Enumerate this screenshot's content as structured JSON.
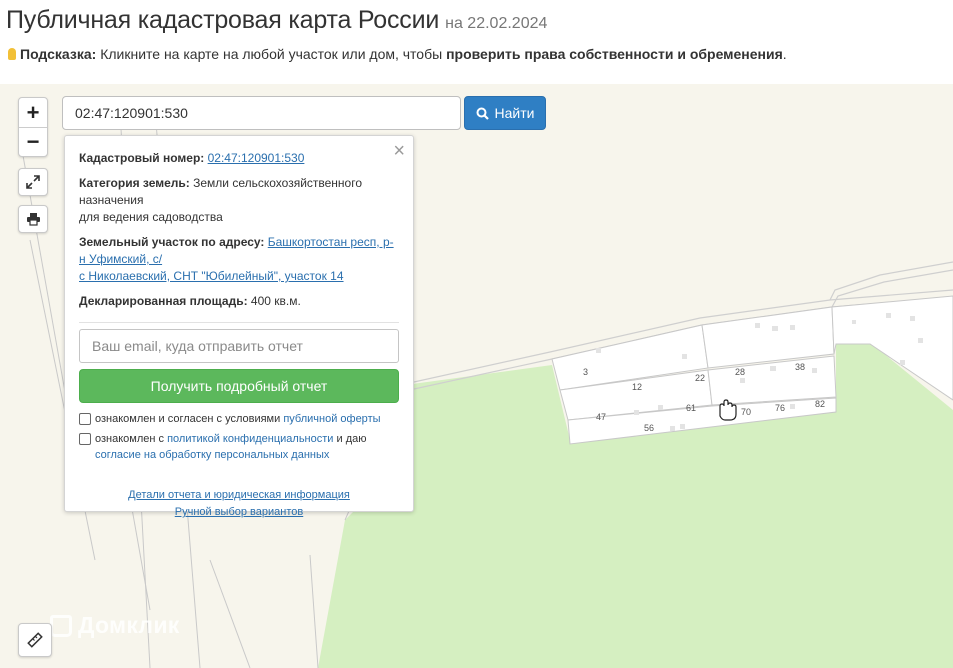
{
  "header": {
    "title": "Публичная кадастровая карта России",
    "date": "на 22.02.2024"
  },
  "hint": {
    "label": "Подсказка:",
    "text": "Кликните на карте на любой участок или дом, чтобы",
    "bold_text": "проверить права собственности и обременения",
    "end": "."
  },
  "search": {
    "value": "02:47:120901:530",
    "button_label": "Найти"
  },
  "popup": {
    "cadastral_label": "Кадастровый номер:",
    "cadastral_value": "02:47:120901:530",
    "category_label": "Категория земель:",
    "category_value_1": "Земли сельскохозяйственного назначения",
    "category_value_2": "для ведения садоводства",
    "address_label": "Земельный участок по адресу:",
    "address_value_1": "Башкортостан респ, р-н Уфимский, с/",
    "address_value_2": "с Николаевский, СНТ \"Юбилейный\", участок 14",
    "area_label": "Декларированная площадь:",
    "area_value": "400 кв.м.",
    "email_placeholder": "Ваш email, куда отправить отчет",
    "report_button": "Получить подробный отчет",
    "check1_text": "ознакомлен и согласен с условиями",
    "check1_link": "публичной оферты",
    "check2_text_a": "ознакомлен с",
    "check2_link_a": "политикой конфиденциальности",
    "check2_text_b": "и даю",
    "check2_link_b": "согласие на обработку персональных данных",
    "link_details": "Детали отчета и юридическая информация",
    "link_manual": "Ручной выбор вариантов"
  },
  "map": {
    "plot_numbers": [
      "3",
      "12",
      "22",
      "28",
      "38",
      "47",
      "61",
      "70",
      "76",
      "82",
      "56"
    ],
    "watermark": "Домклик",
    "colors": {
      "forest": "#d5efc1",
      "background": "#f7f5ec",
      "accent_blue": "#2f7fc4",
      "report_green": "#5cb85c"
    }
  },
  "controls": {
    "zoom_in": "+",
    "zoom_out": "−",
    "icons": [
      "fullscreen-icon",
      "print-icon",
      "ruler-icon"
    ]
  }
}
